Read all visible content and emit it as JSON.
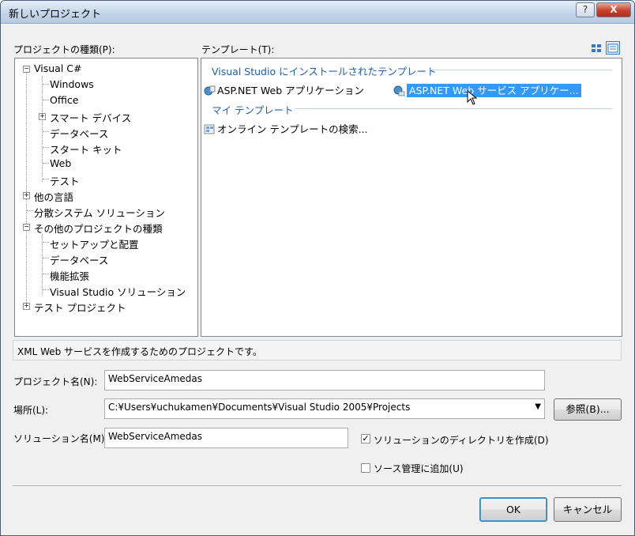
{
  "window": {
    "title": "新しいプロジェクト",
    "help_label": "?",
    "close_label": "X"
  },
  "project_types": {
    "label": "プロジェクトの種類(P):",
    "items": [
      {
        "label": "Visual C#",
        "expanded": true
      },
      {
        "label": "Windows"
      },
      {
        "label": "Office"
      },
      {
        "label": "スマート デバイス"
      },
      {
        "label": "データベース"
      },
      {
        "label": "スタート キット"
      },
      {
        "label": "Web"
      },
      {
        "label": "テスト"
      },
      {
        "label": "他の言語"
      },
      {
        "label": "分散システム ソリューション"
      },
      {
        "label": "その他のプロジェクトの種類"
      },
      {
        "label": "セットアップと配置"
      },
      {
        "label": "データベース"
      },
      {
        "label": "機能拡張"
      },
      {
        "label": "Visual Studio ソリューション"
      },
      {
        "label": "テスト プロジェクト"
      }
    ]
  },
  "templates": {
    "label": "テンプレート(T):",
    "installed_header": "Visual Studio にインストールされたテンプレート",
    "installed": [
      {
        "label": "ASP.NET Web アプリケーション",
        "icon": "web-app-icon"
      },
      {
        "label": "ASP.NET Web サービス アプリケー...",
        "icon": "web-service-icon",
        "selected": true
      }
    ],
    "my_header": "マイ テンプレート",
    "my": [
      {
        "label": "オンライン テンプレートの検索...",
        "icon": "search-online-icon"
      }
    ]
  },
  "description": "XML Web サービスを作成するためのプロジェクトです。",
  "form": {
    "project_name_label": "プロジェクト名(N):",
    "project_name_value": "WebServiceAmedas",
    "location_label": "場所(L):",
    "location_value": "C:¥Users¥uchukamen¥Documents¥Visual Studio 2005¥Projects",
    "browse_label": "参照(B)...",
    "solution_name_label": "ソリューション名(M):",
    "solution_name_value": "WebServiceAmedas",
    "create_dir_label": "ソリューションのディレクトリを作成(D)",
    "create_dir_checked": true,
    "source_control_label": "ソース管理に追加(U)",
    "source_control_checked": false
  },
  "buttons": {
    "ok": "OK",
    "cancel": "キャンセル"
  },
  "colors": {
    "selection": "#3399ff",
    "section_header": "#1e5fb5"
  }
}
